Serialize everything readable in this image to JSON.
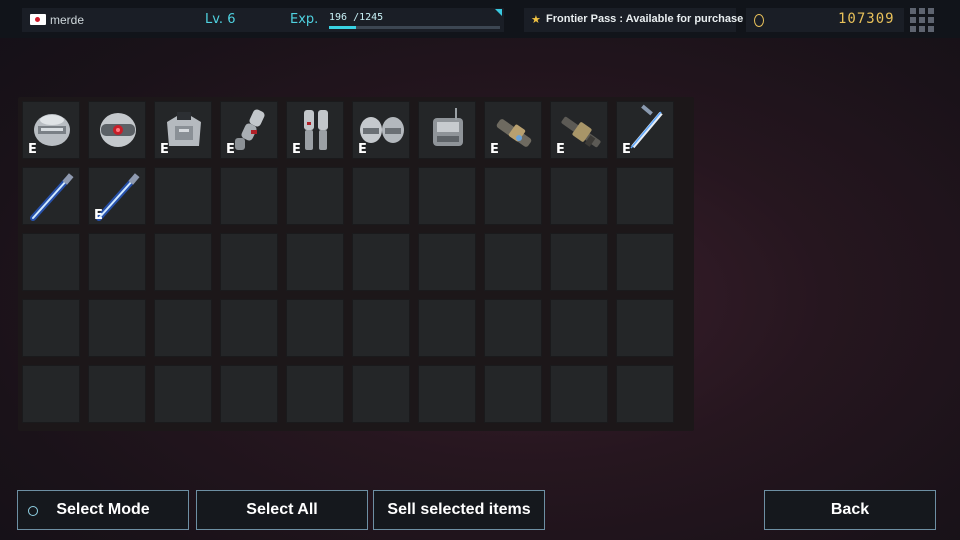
{
  "player": {
    "name": "merde",
    "level": "Lv. 6"
  },
  "exp": {
    "label": "Exp.",
    "value": "196 /1245",
    "progress": 0.157
  },
  "pass": {
    "star": "★",
    "text": "Frontier Pass : Available for purchase"
  },
  "currency": {
    "amount": "107309",
    "color": "#e8c15a"
  },
  "inventory": {
    "equipped_marker": "E",
    "items": [
      {
        "icon": "helmet-icon",
        "equipped": true
      },
      {
        "icon": "helmet-red-visor-icon",
        "equipped": false
      },
      {
        "icon": "chest-armor-icon",
        "equipped": true
      },
      {
        "icon": "arm-armor-icon",
        "equipped": true
      },
      {
        "icon": "leg-armor-icon",
        "equipped": true
      },
      {
        "icon": "shoulder-armor-icon",
        "equipped": true
      },
      {
        "icon": "backpack-icon",
        "equipped": false
      },
      {
        "icon": "cannon-icon",
        "equipped": true
      },
      {
        "icon": "rifle-icon",
        "equipped": true
      },
      {
        "icon": "sword-icon",
        "equipped": true
      },
      {
        "icon": "energy-sword-icon",
        "equipped": false
      },
      {
        "icon": "energy-sword-icon",
        "equipped": true
      }
    ]
  },
  "buttons": {
    "select_mode": "Select Mode",
    "select_all": "Select All",
    "sell": "Sell selected items",
    "back": "Back"
  }
}
